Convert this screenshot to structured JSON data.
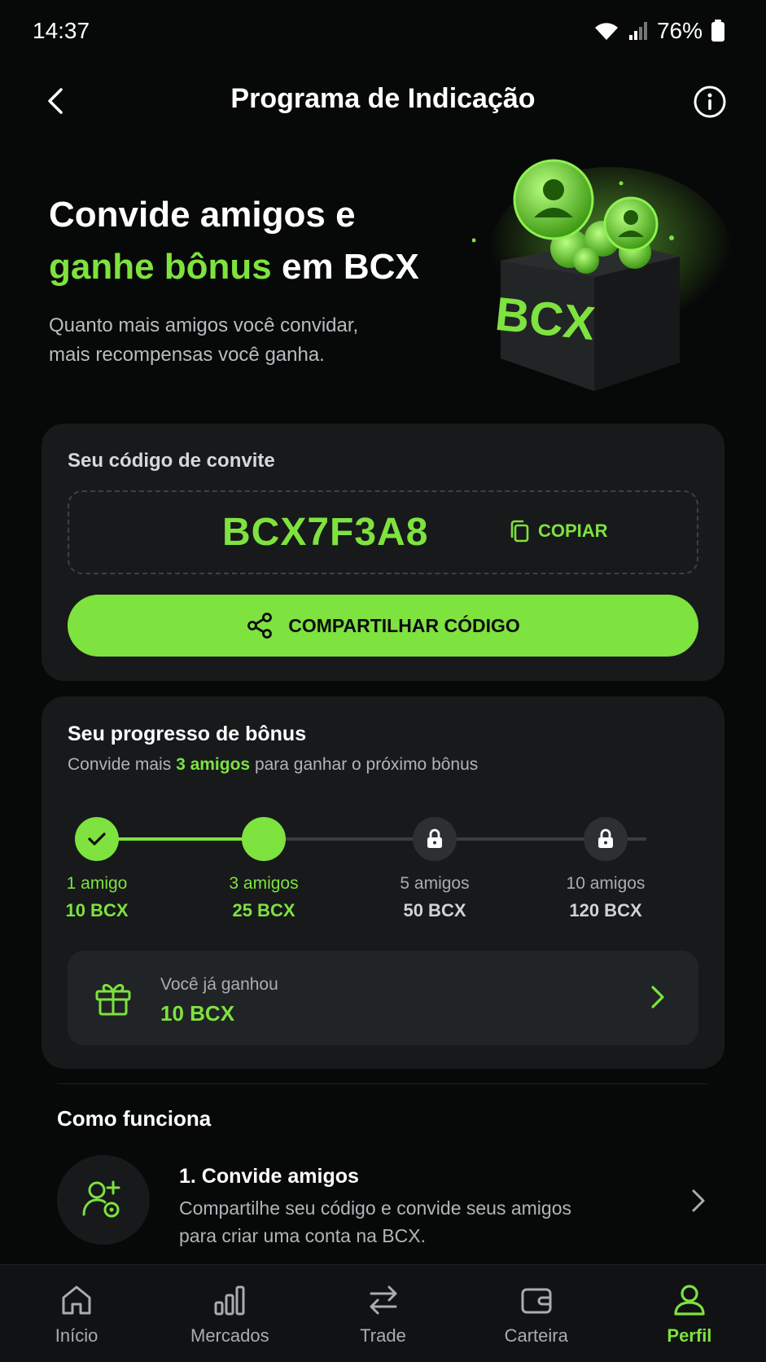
{
  "status_bar": {
    "time": "14:37",
    "battery": "76%"
  },
  "header": {
    "title": "Programa de Indicação"
  },
  "hero": {
    "title_line1": "Convide amigos e",
    "title_accent": "ganhe bônus",
    "title_rest": " em BCX",
    "subtitle_line1": "Quanto mais amigos você convidar,",
    "subtitle_line2": "mais recompensas você ganha.",
    "box_label": "BCX"
  },
  "invite": {
    "label": "Seu código de convite",
    "code": "BCX7F3A8",
    "copy_label": "COPIAR",
    "share_label": "COMPARTILHAR CÓDIGO"
  },
  "progress": {
    "title": "Seu progresso de bônus",
    "sub_prefix": "Convide mais ",
    "sub_highlight": "3 amigos",
    "sub_suffix": " para ganhar o próximo bônus",
    "fill_fraction": 0.333,
    "steps": [
      {
        "label": "1 amigo",
        "amount": "10 BCX",
        "state": "done"
      },
      {
        "label": "3 amigos",
        "amount": "25 BCX",
        "state": "current"
      },
      {
        "label": "5 amigos",
        "amount": "50 BCX",
        "state": "locked"
      },
      {
        "label": "10 amigos",
        "amount": "120 BCX",
        "state": "locked"
      }
    ],
    "earned_label": "Você já ganhou",
    "earned_value": "10 BCX"
  },
  "how": {
    "title": "Como funciona",
    "items": [
      {
        "title": "1. Convide amigos",
        "desc_line1": "Compartilhe seu código e convide seus amigos",
        "desc_line2": "para criar uma conta na BCX."
      }
    ]
  },
  "nav": {
    "items": [
      {
        "label": "Início",
        "icon": "home-icon"
      },
      {
        "label": "Mercados",
        "icon": "markets-icon"
      },
      {
        "label": "Trade",
        "icon": "trade-icon"
      },
      {
        "label": "Carteira",
        "icon": "wallet-icon"
      },
      {
        "label": "Perfil",
        "icon": "profile-icon",
        "active": true
      }
    ]
  },
  "colors": {
    "accent": "#7ee23f",
    "background": "#070808",
    "card": "#17191b"
  }
}
